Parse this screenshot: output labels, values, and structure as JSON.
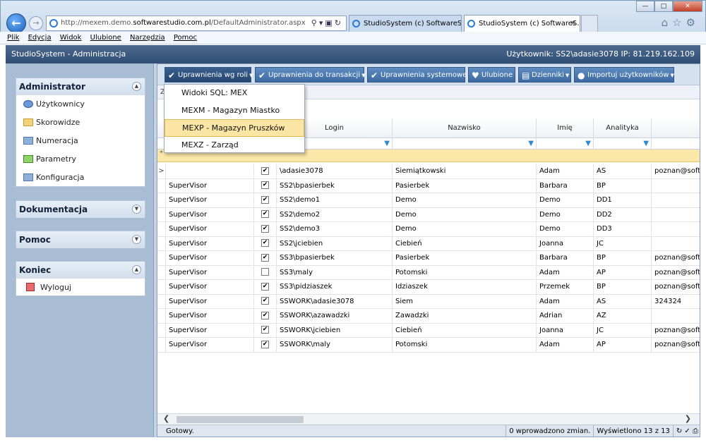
{
  "browser": {
    "url_prefix": "http://mexem.demo.",
    "url_domain": "softwarestudio.com.pl",
    "url_path": "/DefaultAdministrator.aspx",
    "tabs": [
      {
        "label": "StudioSystem (c) SoftwareStud..."
      },
      {
        "label": "StudioSystem (c) SoftwareS..."
      }
    ],
    "menu": [
      "Plik",
      "Edycja",
      "Widok",
      "Ulubione",
      "Narzędzia",
      "Pomoc"
    ]
  },
  "app": {
    "title": "StudioSystem - Administracja",
    "user_info": "Użytkownik: SS2\\adasie3078 IP: 81.219.162.109"
  },
  "sidebar": {
    "administrator": {
      "title": "Administrator",
      "items": [
        {
          "label": "Użytkownicy",
          "icon": "users-icon"
        },
        {
          "label": "Skorowidze",
          "icon": "folder-icon"
        },
        {
          "label": "Numeracja",
          "icon": "box-icon"
        },
        {
          "label": "Parametry",
          "icon": "parameters-icon"
        },
        {
          "label": "Konfiguracja",
          "icon": "folder-icon"
        }
      ]
    },
    "dokumentacja": {
      "title": "Dokumentacja"
    },
    "pomoc": {
      "title": "Pomoc"
    },
    "koniec": {
      "title": "Koniec",
      "items": [
        {
          "label": "Wyloguj",
          "icon": "logout-icon"
        }
      ]
    }
  },
  "toolbar": {
    "buttons": [
      {
        "label": "Uprawnienia wg roli",
        "icon": "check-icon"
      },
      {
        "label": "Uprawnienia do transakcji",
        "icon": "check-icon"
      },
      {
        "label": "Uprawnienia systemowe",
        "icon": "check-icon"
      },
      {
        "label": "Ulubione",
        "icon": "heart-icon"
      },
      {
        "label": "Dzienniki",
        "icon": "journal-icon"
      },
      {
        "label": "Importuj użytkowników",
        "icon": "users-icon"
      }
    ]
  },
  "dropdown": {
    "items": [
      {
        "label": "Widoki SQL: MEX"
      },
      {
        "label": "MEXM - Magazyn Miastko"
      },
      {
        "label": "MEXP - Magazyn Pruszków"
      },
      {
        "label": "MEXZ - Zarząd"
      }
    ],
    "highlighted": 2
  },
  "grid": {
    "group_hint": "Z",
    "columns": {
      "login": "Login",
      "nazwisko": "Nazwisko",
      "imie": "Imię",
      "analityka": "Analityka"
    },
    "new_row_marker": "*",
    "current_row_marker": ">",
    "rows": [
      {
        "rola": "",
        "active": true,
        "login": "\\adasie3078",
        "nazwisko": "Siemiątkowski",
        "imie": "Adam",
        "analityka": "AS",
        "email": "poznan@softw"
      },
      {
        "rola": "SuperVisor",
        "active": true,
        "login": "SS2\\bpasierbek",
        "nazwisko": "Pasierbek",
        "imie": "Barbara",
        "analityka": "BP",
        "email": ""
      },
      {
        "rola": "SuperVisor",
        "active": true,
        "login": "SS2\\demo1",
        "nazwisko": "Demo",
        "imie": "Demo",
        "analityka": "DD1",
        "email": ""
      },
      {
        "rola": "SuperVisor",
        "active": true,
        "login": "SS2\\demo2",
        "nazwisko": "Demo",
        "imie": "Demo",
        "analityka": "DD2",
        "email": ""
      },
      {
        "rola": "SuperVisor",
        "active": true,
        "login": "SS2\\demo3",
        "nazwisko": "Demo",
        "imie": "Demo",
        "analityka": "DD3",
        "email": ""
      },
      {
        "rola": "SuperVisor",
        "active": true,
        "login": "SS2\\jciebien",
        "nazwisko": "Ciebień",
        "imie": "Joanna",
        "analityka": "JC",
        "email": ""
      },
      {
        "rola": "SuperVisor",
        "active": true,
        "login": "SS3\\bpasierbek",
        "nazwisko": "Pasierbek",
        "imie": "Barbara",
        "analityka": "BP",
        "email": "poznan@softw"
      },
      {
        "rola": "SuperVisor",
        "active": false,
        "login": "SS3\\maly",
        "nazwisko": "Potomski",
        "imie": "Adam",
        "analityka": "AP",
        "email": "poznan@softw"
      },
      {
        "rola": "SuperVisor",
        "active": true,
        "login": "SS3\\pidziaszek",
        "nazwisko": "Idziaszek",
        "imie": "Przemek",
        "analityka": "BP",
        "email": "poznan@softw"
      },
      {
        "rola": "SuperVisor",
        "active": true,
        "login": "SSWORK\\adasie3078",
        "nazwisko": "Siem",
        "imie": "Adam",
        "analityka": "AS",
        "email": "324324"
      },
      {
        "rola": "SuperVisor",
        "active": true,
        "login": "SSWORK\\azawadzki",
        "nazwisko": "Zawadzki",
        "imie": "Adrian",
        "analityka": "AZ",
        "email": ""
      },
      {
        "rola": "SuperVisor",
        "active": true,
        "login": "SSWORK\\jciebien",
        "nazwisko": "Ciebień",
        "imie": "Joanna",
        "analityka": "JC",
        "email": "poznan@softw"
      },
      {
        "rola": "SuperVisor",
        "active": true,
        "login": "SSWORK\\maly",
        "nazwisko": "Potomski",
        "imie": "Adam",
        "analityka": "AP",
        "email": "poznan@softw"
      }
    ]
  },
  "statusbar": {
    "ready": "Gotowy.",
    "changes": "0 wprowadzono zmian.",
    "displayed": "Wyświetlono 13 z 13"
  }
}
